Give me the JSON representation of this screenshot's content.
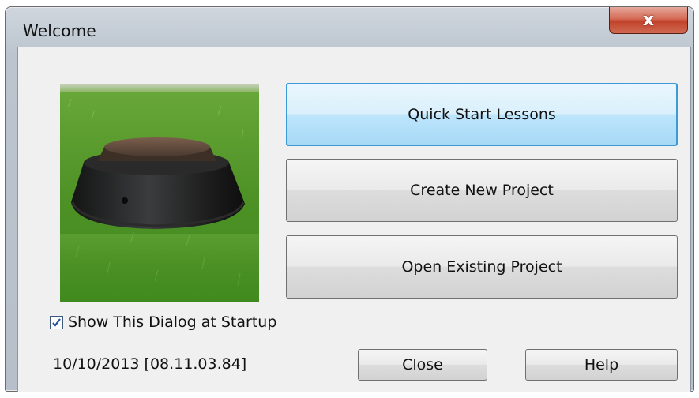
{
  "window": {
    "title": "Welcome",
    "close_glyph": "x"
  },
  "image": {
    "icon": "grass-and-manhole-photo"
  },
  "buttons": {
    "quick_start": "Quick Start Lessons",
    "create_new": "Create New Project",
    "open_existing": "Open Existing Project",
    "close": "Close",
    "help": "Help"
  },
  "startup_checkbox": {
    "label": "Show This Dialog at Startup",
    "checked": true
  },
  "version_text": "10/10/2013 [08.11.03.84]",
  "colors": {
    "focus_border": "#3c9ad6",
    "close_button": "#c2432b",
    "check_mark": "#1e4f9e"
  }
}
